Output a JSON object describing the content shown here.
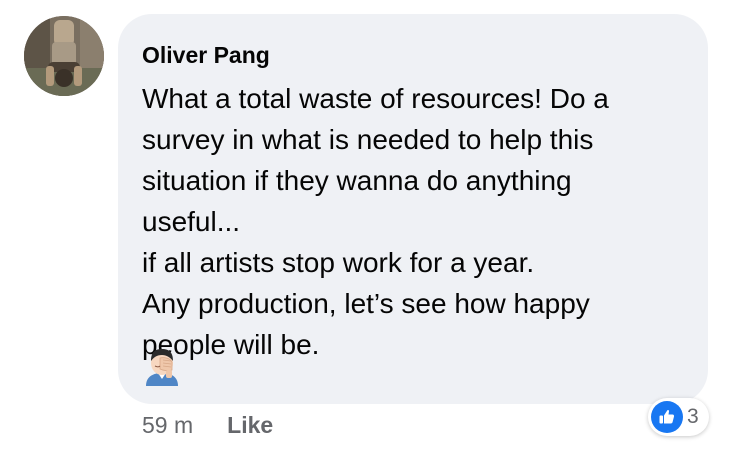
{
  "comment": {
    "author": "Oliver Pang",
    "lines": [
      "What a total waste of resources! Do a",
      "survey in what is needed to help this",
      "situation if they wanna do anything",
      "useful...",
      "if all artists stop work for a year.",
      "Any production, let’s see how happy",
      "people will be."
    ],
    "emoji": "man-facepalming-emoji"
  },
  "meta": {
    "timestamp": "59 m",
    "like_label": "Like"
  },
  "reactions": {
    "icon": "thumbs-up-icon",
    "count": "3",
    "color": "#1877f2"
  },
  "colors": {
    "bubble_background": "#eff1f5",
    "meta_text": "#65676b"
  }
}
